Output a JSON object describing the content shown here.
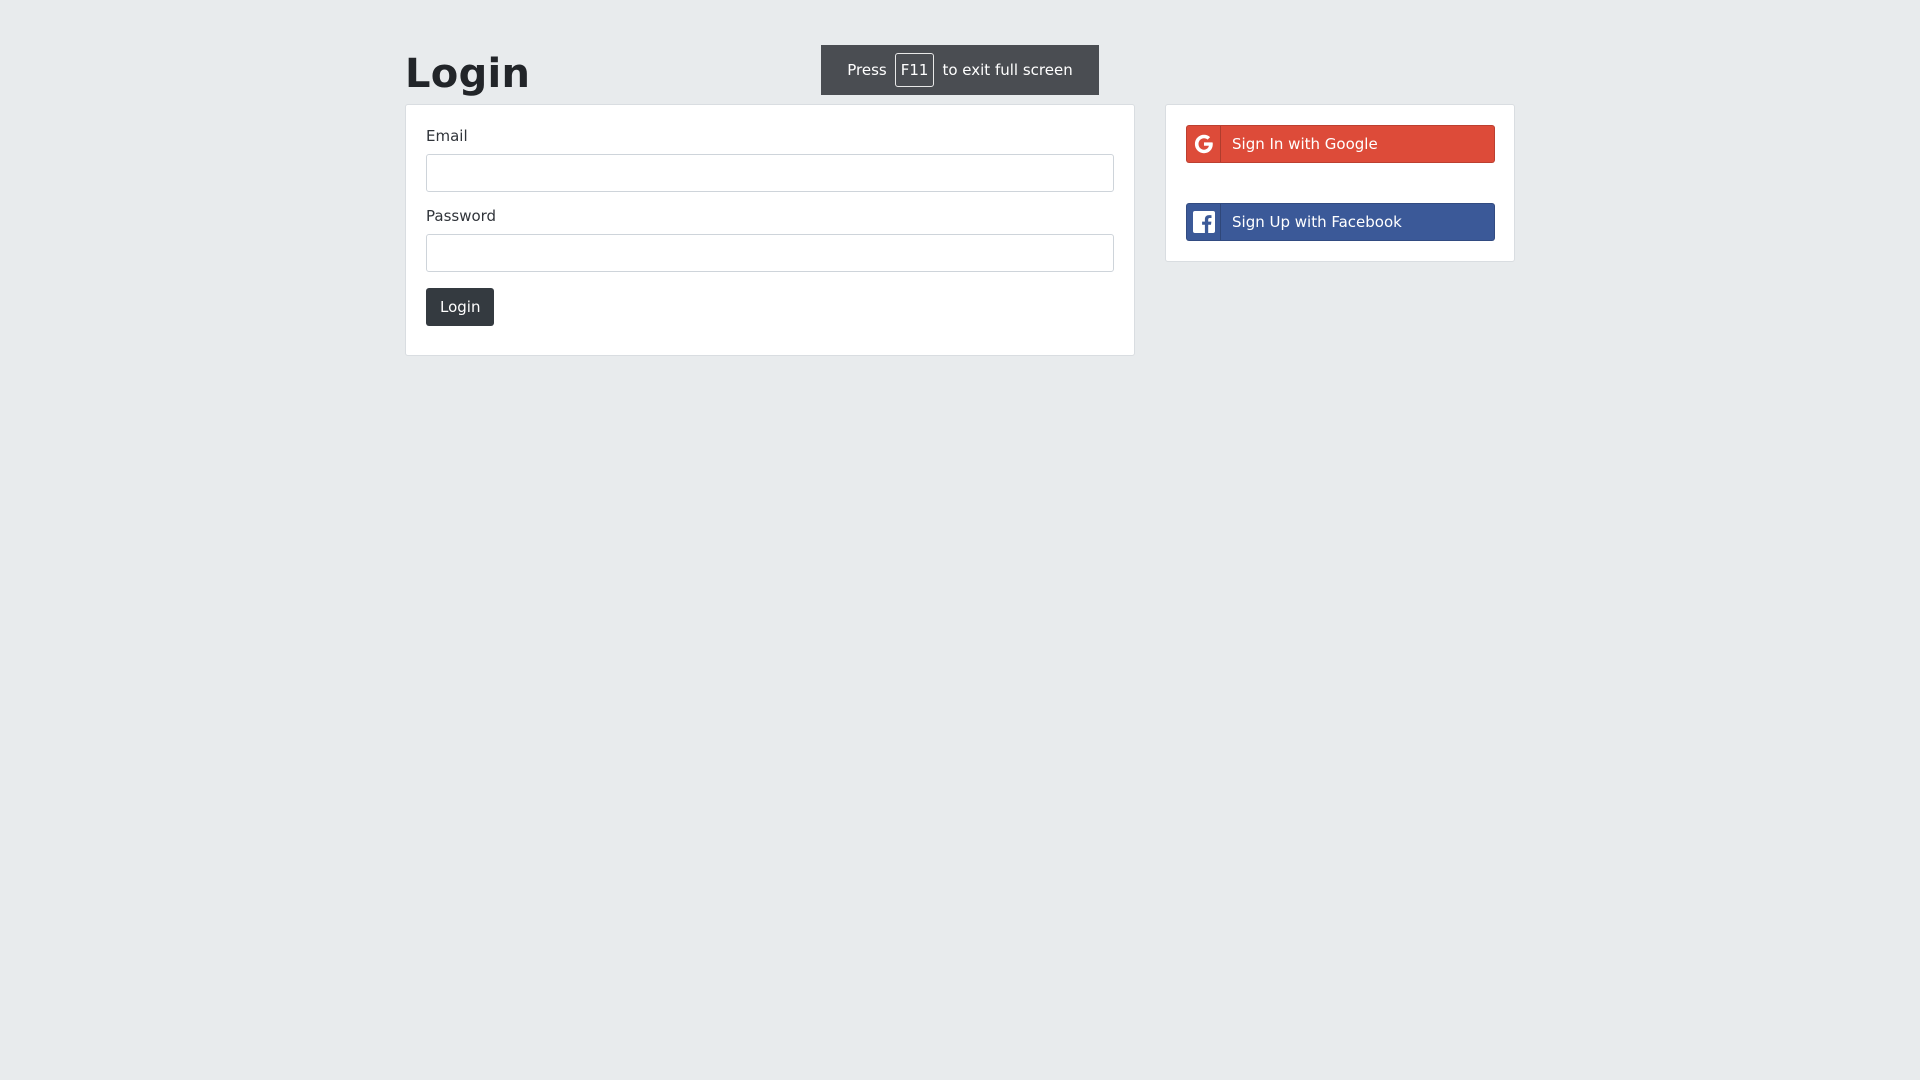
{
  "fullscreen_notice": {
    "prefix": "Press",
    "key": "F11",
    "suffix": "to exit full screen"
  },
  "page": {
    "title": "Login"
  },
  "login_form": {
    "email_label": "Email",
    "email_value": "",
    "email_placeholder": "",
    "password_label": "Password",
    "password_value": "",
    "password_placeholder": "",
    "submit_label": "Login"
  },
  "social": {
    "google_label": "Sign In with Google",
    "google_icon": "google-icon",
    "google_color": "#dd4b39",
    "facebook_label": "Sign Up with Facebook",
    "facebook_icon": "facebook-icon",
    "facebook_color": "#3b5998"
  },
  "colors": {
    "background": "#e8ebed",
    "dark_button": "#343a40",
    "notice_bg": "#4a4d52"
  }
}
